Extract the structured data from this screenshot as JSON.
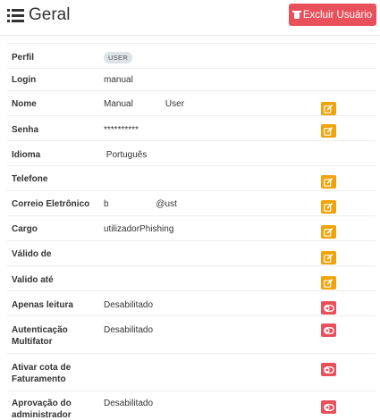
{
  "header": {
    "title": "Geral",
    "title_icon": "list-icon",
    "delete_button": {
      "label": "Excluir Usuário",
      "icon": "trash-icon",
      "color": "#e8505b"
    }
  },
  "colors": {
    "edit_button": "#f0a30a",
    "toggle_button": "#e8505b",
    "badge_bg": "#dde3e6"
  },
  "fields": [
    {
      "label": "Perfil",
      "value": "USER",
      "badge": true,
      "action": "none"
    },
    {
      "label": "Login",
      "value": "manual",
      "action": "none"
    },
    {
      "label": "Nome",
      "value": "Manual             User",
      "action": "edit"
    },
    {
      "label": "Senha",
      "value": "**********",
      "action": "edit"
    },
    {
      "label": "Idioma",
      "value": " Português",
      "action": "none"
    },
    {
      "label": "Telefone",
      "value": "",
      "action": "edit"
    },
    {
      "label": "Correio Eletrônico",
      "value": "b                   @ust",
      "action": "edit"
    },
    {
      "label": "Cargo",
      "value": "utilizadorPhishing",
      "action": "edit"
    },
    {
      "label": "Válido de",
      "value": "",
      "action": "edit"
    },
    {
      "label": "Valido até",
      "value": "",
      "action": "edit"
    },
    {
      "label": "Apenas leitura",
      "value": "Desabilitado",
      "action": "toggle"
    },
    {
      "label": "Autenticação Multifator",
      "value": "Desabilitado",
      "action": "toggle"
    },
    {
      "label": "Ativar cota de Faturamento",
      "value": "",
      "action": "toggle"
    },
    {
      "label": "Aprovação do administrador",
      "value": "Desabilitado",
      "action": "toggle"
    }
  ]
}
